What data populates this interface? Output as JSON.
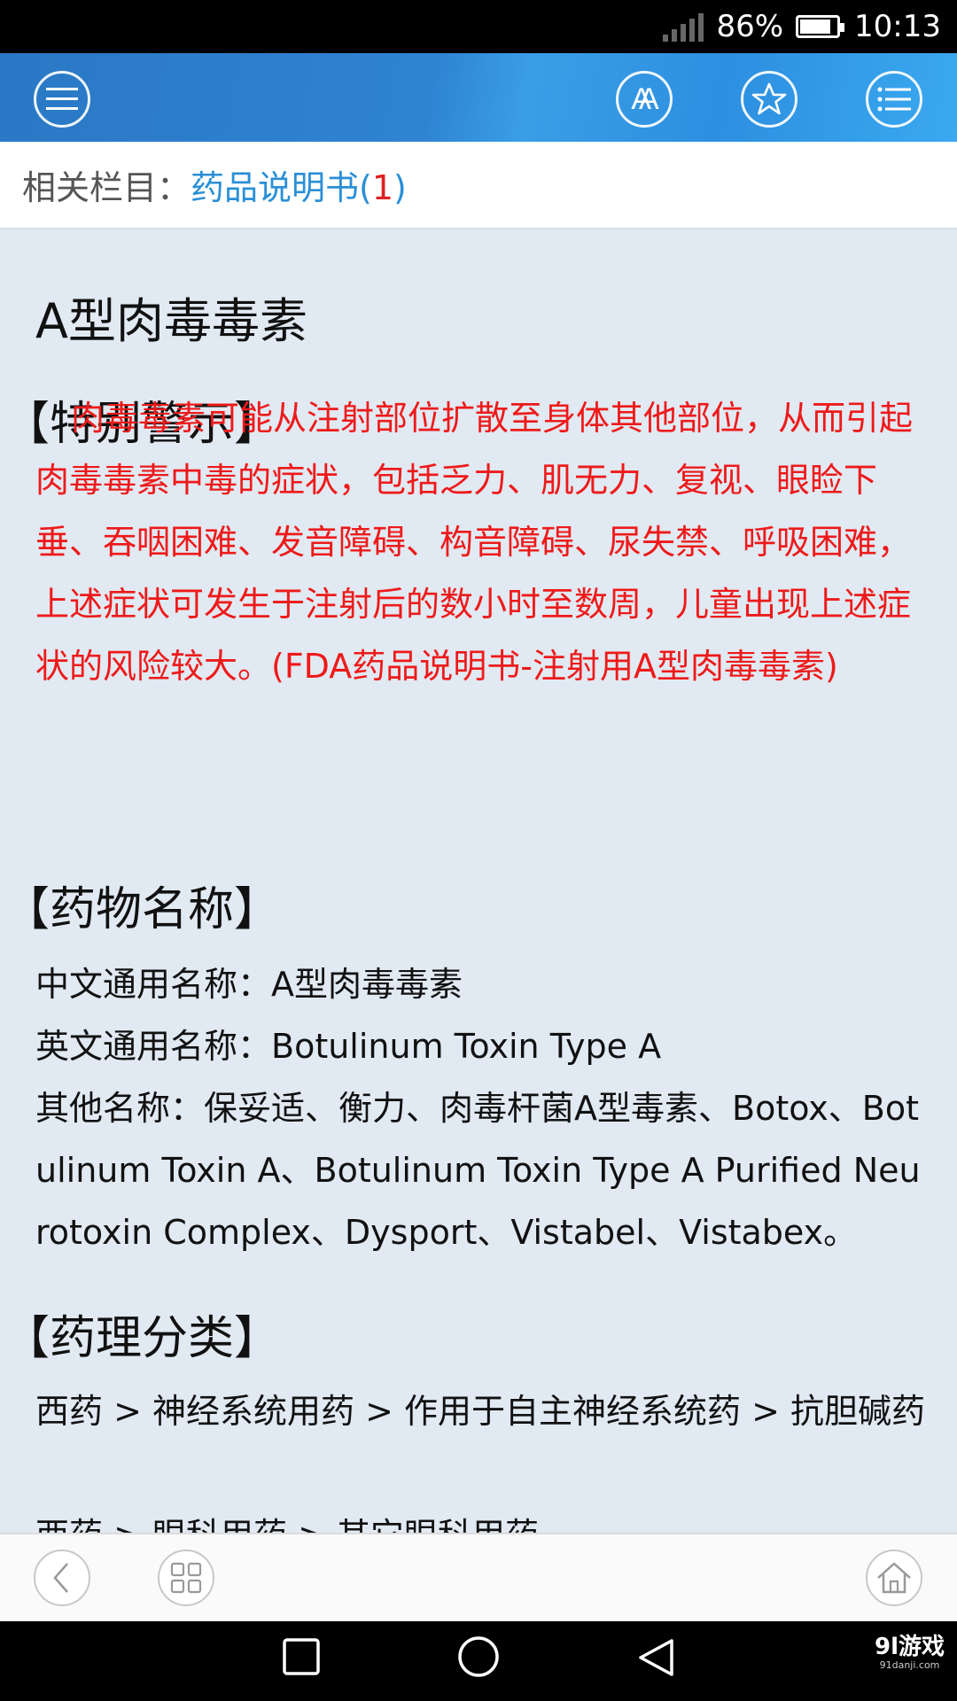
{
  "status_bar": {
    "battery": "86%",
    "time": "10:13"
  },
  "related": {
    "label": "相关栏目：",
    "link": "药品说明书(",
    "count": "1",
    "close": ")"
  },
  "article": {
    "title": "A型肉毒毒素",
    "sections": [
      {
        "heading": "【特别警示】",
        "text": "肉毒毒素可能从注射部位扩散至身体其他部位，从而引起肉毒毒素中毒的症状，包括乏力、肌无力、复视、眼睑下垂、吞咽困难、发音障碍、构音障碍、尿失禁、呼吸困难，上述症状可发生于注射后的数小时至数周，儿童出现上述症状的风险较大。(FDA药品说明书-注射用A型肉毒毒素)"
      },
      {
        "heading": "【药物名称】",
        "lines": [
          "中文通用名称：A型肉毒毒素",
          "英文通用名称：Botulinum Toxin Type A",
          "其他名称：保妥适、衡力、肉毒杆菌A型毒素、Botox、Botulinum Toxin A、Botulinum Toxin Type A Purified Neurotoxin Complex、Dysport、Vistabel、Vistabex。"
        ]
      },
      {
        "heading": "【药理分类】",
        "lines": [
          "西药 > 神经系统用药 > 作用于自主神经系统药 > 抗胆碱药",
          "西药 > 眼科用药 > 其它眼科用药"
        ]
      }
    ]
  },
  "toolbar": {
    "menu_icon": "menu-icon",
    "font_icon": "font-size-icon",
    "font_label": "AA",
    "favorite_icon": "star-icon",
    "list_icon": "list-icon"
  },
  "bottom_bar": {
    "back_icon": "chevron-left-icon",
    "grid_icon": "grid-icon",
    "home_icon": "home-icon"
  },
  "watermark": {
    "main": "9l游戏",
    "sub": "91danji.com"
  },
  "colors": {
    "toolbar": "#2f84d2",
    "link": "#2a8fd6",
    "warning": "#ee1a1a",
    "background": "#e1e9f2"
  }
}
